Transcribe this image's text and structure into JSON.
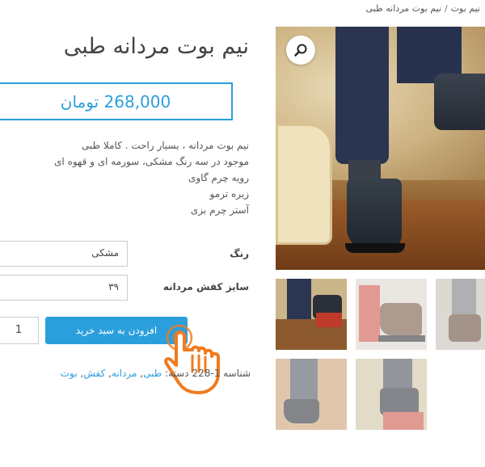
{
  "breadcrumb": {
    "items": [
      "نیم بوت",
      "نیم بوت مردانه طبی"
    ],
    "separator": "/"
  },
  "product": {
    "title": "نیم بوت مردانه طبی",
    "price": "268,000 تومان",
    "description": [
      "نیم بوت مردانه ، بسیار راحت . کاملا طبی",
      "موجود در سه رنگ مشکی، سورمه ای و قهوه ای",
      "رویه چرم گاوی",
      "زیره ترمو",
      "آستر چرم بزی"
    ]
  },
  "options": {
    "color": {
      "label": "رنگ",
      "value": "مشکی"
    },
    "size": {
      "label": "سایز کفش مردانه",
      "value": "۳۹"
    }
  },
  "cart": {
    "quantity": "1",
    "add_label": "افزودن به سبد خرید"
  },
  "meta": {
    "sku_label": "شناسه",
    "sku_value": "1-228",
    "category_label": "دسته:",
    "categories": [
      "طبی",
      "مردانه",
      "کفش",
      "بوت"
    ]
  },
  "icons": {
    "zoom": "search-icon",
    "pointer": "hand-pointer-icon"
  },
  "colors": {
    "accent": "#2b9fdc",
    "pointer": "#f07b1d"
  }
}
